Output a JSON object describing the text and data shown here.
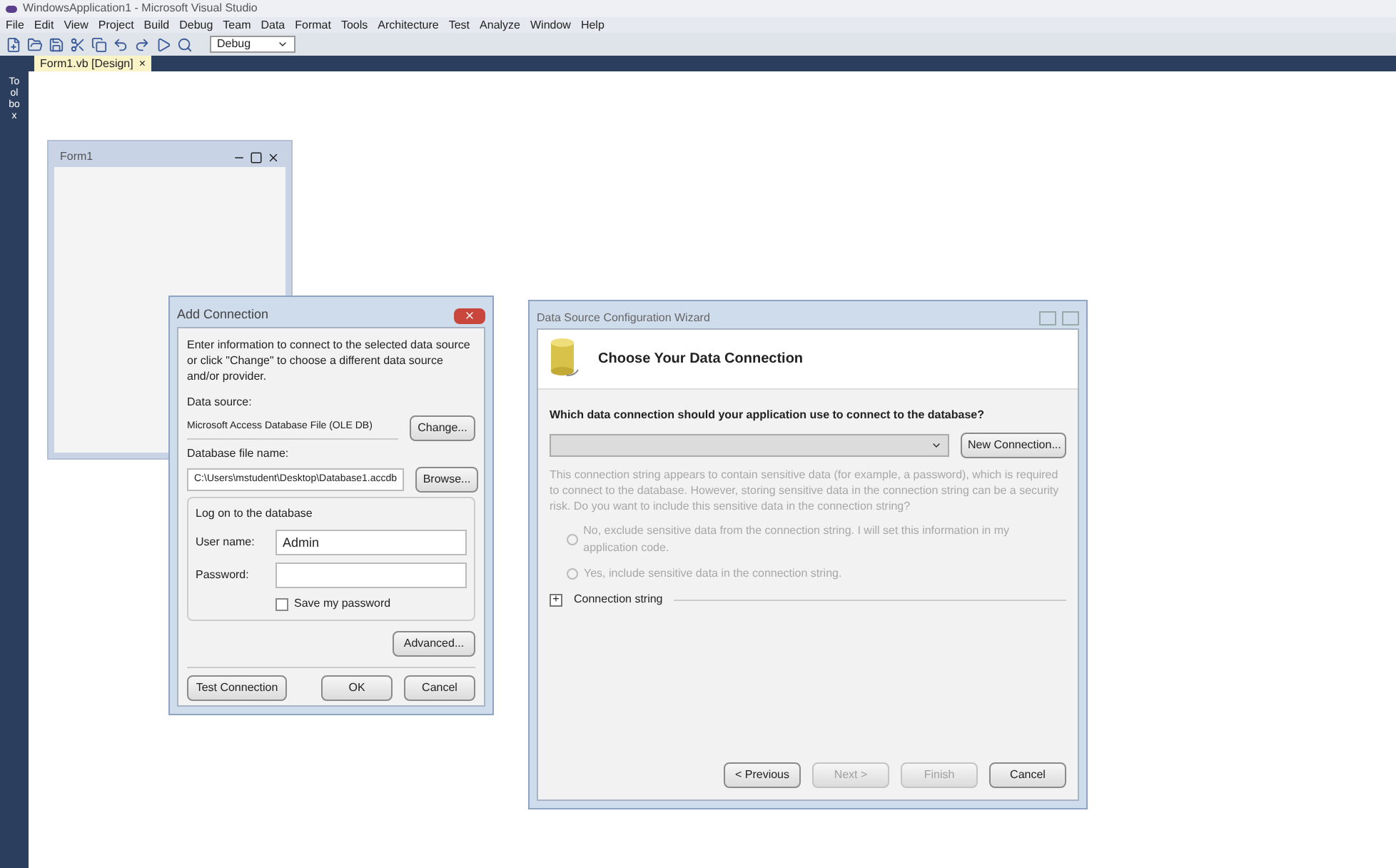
{
  "window": {
    "title": "WindowsApplication1 - Microsoft Visual Studio"
  },
  "menu": [
    "File",
    "Edit",
    "View",
    "Project",
    "Build",
    "Debug",
    "Team",
    "Data",
    "Format",
    "Tools",
    "Architecture",
    "Test",
    "Analyze",
    "Window",
    "Help"
  ],
  "toolbar": {
    "configuration": "Debug"
  },
  "toolbox": {
    "label": "Toolbox"
  },
  "document_tabs": [
    {
      "label": "Form1.vb [Design]",
      "selected": true,
      "close": "×"
    }
  ],
  "form": {
    "title": "Form1"
  },
  "add_connection": {
    "title": "Add Connection",
    "intro": "Enter information to connect to the selected data source or click \"Change\" to choose a different data source and/or provider.",
    "data_source_label": "Data source:",
    "data_source": "Microsoft Access Database File (OLE DB)",
    "change": "Change...",
    "file_label": "Database file name:",
    "file": "C:\\Users\\mstudent\\Desktop\\Database1.accdb",
    "browse": "Browse...",
    "logon_group": "Log on to the database",
    "user_label": "User name:",
    "user": "Admin",
    "password_label": "Password:",
    "save_password": {
      "label": "Save my password",
      "checked": false
    },
    "advanced": "Advanced...",
    "test": "Test Connection",
    "ok": "OK",
    "cancel": "Cancel"
  },
  "wizard": {
    "title": "Data Source Configuration Wizard",
    "heading": "Choose Your Data Connection",
    "question": "Which data connection should your application use to connect to the database?",
    "new_connection": "New Connection...",
    "warning": "This connection string appears to contain sensitive data (for example, a password), which is required to connect to the database. However, storing sensitive data in the connection string can be a security risk. Do you want to include this sensitive data in the connection string?",
    "options": [
      {
        "label": "No, exclude sensitive data from the connection string. I will set this information in my application code.",
        "selected": false,
        "disabled": true
      },
      {
        "label": "Yes, include sensitive data in the connection string.",
        "selected": false,
        "disabled": true
      }
    ],
    "connection_string": {
      "label": "Connection string",
      "expanded": false,
      "toggle": "+"
    },
    "buttons": [
      {
        "label": "< Previous",
        "disabled": false
      },
      {
        "label": "Next >",
        "disabled": true
      },
      {
        "label": "Finish",
        "disabled": true
      },
      {
        "label": "Cancel",
        "disabled": false
      }
    ]
  }
}
